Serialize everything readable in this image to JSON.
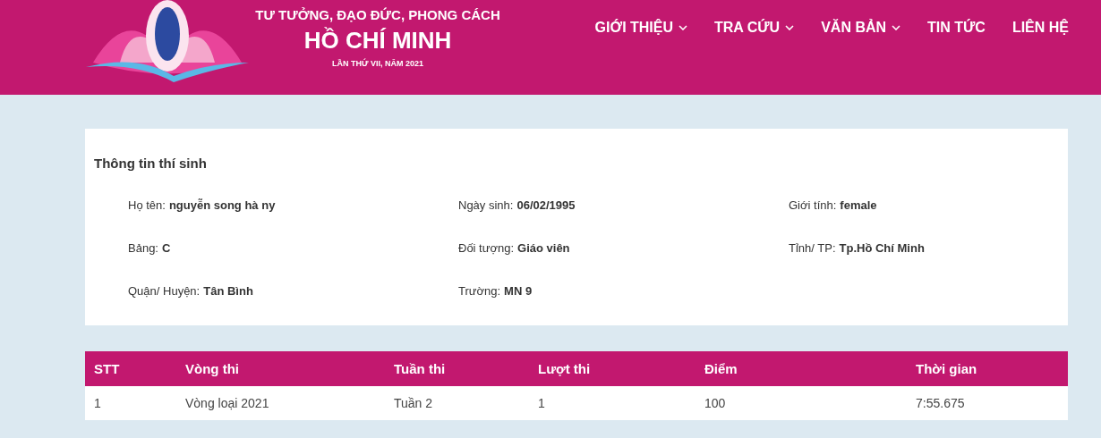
{
  "header": {
    "title_lines": [
      {
        "text": "TƯ TƯỞNG, ĐẠO ĐỨC, PHONG CÁCH",
        "kind": "sub"
      },
      {
        "text": "HỒ CHÍ MINH",
        "kind": "main"
      },
      {
        "text": "LẦN THỨ VII, NĂM 2021",
        "kind": "small"
      }
    ],
    "nav": [
      {
        "label": "GIỚI THIỆU",
        "dropdown": true
      },
      {
        "label": "TRA CỨU",
        "dropdown": true
      },
      {
        "label": "VĂN BẢN",
        "dropdown": true
      },
      {
        "label": "TIN TỨC",
        "dropdown": false
      },
      {
        "label": "LIÊN HỆ",
        "dropdown": false
      }
    ]
  },
  "candidate": {
    "title": "Thông tin thí sinh",
    "fields": [
      {
        "label": "Họ tên:",
        "value": "nguyễn song hà ny"
      },
      {
        "label": "Ngày sinh:",
        "value": "06/02/1995"
      },
      {
        "label": "Giới tính:",
        "value": "female"
      },
      {
        "label": "Bảng:",
        "value": "C"
      },
      {
        "label": "Đối tượng:",
        "value": "Giáo viên"
      },
      {
        "label": "Tỉnh/ TP:",
        "value": "Tp.Hồ Chí Minh"
      },
      {
        "label": "Quận/ Huyện:",
        "value": "Tân Bình"
      },
      {
        "label": "Trường:",
        "value": "MN 9"
      }
    ]
  },
  "table": {
    "columns": [
      "STT",
      "Vòng thi",
      "Tuần thi",
      "Lượt thi",
      "Điểm",
      "Thời gian"
    ],
    "rows": [
      [
        "1",
        "Vòng loại 2021",
        "Tuần 2",
        "1",
        "100",
        "7:55.675"
      ]
    ]
  }
}
